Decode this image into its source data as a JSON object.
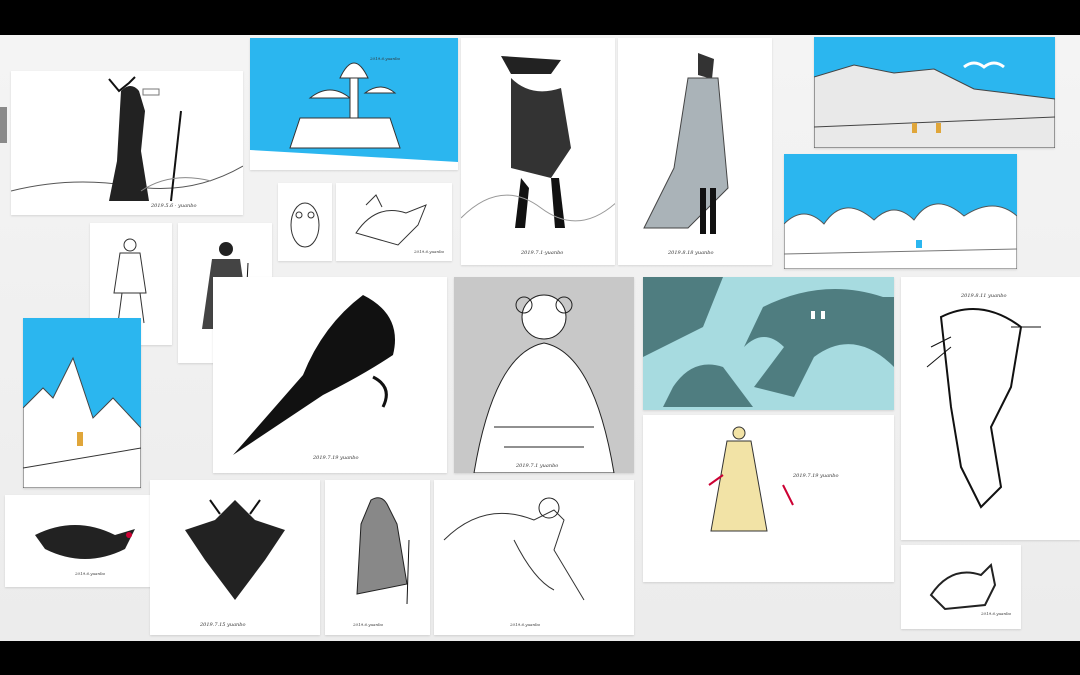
{
  "window": {
    "title": ""
  },
  "signatures": {
    "s1": "2019.5.6 · yuanbo",
    "s2": "2019.6.yuanbo",
    "s3": "2019.7.1·yuanbo",
    "s4": "2019.8.18 yuanbo",
    "s5": "2019.7.19 yuanbo",
    "s6": "2019.7.1 yuanbo",
    "s7": "2019.8.11 yuanbo",
    "s8": "2019.7.15 yuanbo",
    "s9": "2019.7.19 yuanbo"
  },
  "colors": {
    "board": "#f0f0f0",
    "sky": "#2bb6ef",
    "teal": "#4f7d80",
    "ochre": "#e0a63a"
  }
}
